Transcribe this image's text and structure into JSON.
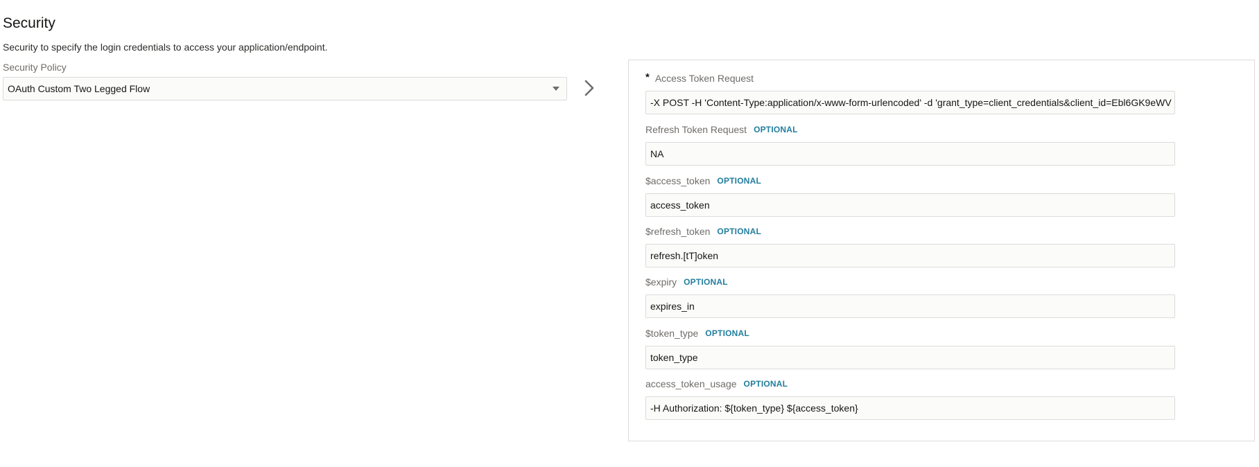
{
  "section": {
    "title": "Security",
    "description": "Security to specify the login credentials to access your application/endpoint."
  },
  "policy": {
    "label": "Security Policy",
    "value": "OAuth Custom Two Legged Flow"
  },
  "optional_tag": "OPTIONAL",
  "fields": [
    {
      "label": "Access Token Request",
      "required": true,
      "value": "-X POST -H 'Content-Type:application/x-www-form-urlencoded' -d 'grant_type=client_credentials&client_id=Ebl6GK9eWV"
    },
    {
      "label": "Refresh Token Request",
      "optional": "OPTIONAL",
      "value": "NA"
    },
    {
      "label": "$access_token",
      "optional": "OPTIONAL",
      "value": "access_token"
    },
    {
      "label": "$refresh_token",
      "optional": "OPTIONAL",
      "value": "refresh.[tT]oken"
    },
    {
      "label": "$expiry",
      "optional": "OPTIONAL",
      "value": "expires_in"
    },
    {
      "label": "$token_type",
      "optional": "OPTIONAL",
      "value": "token_type"
    },
    {
      "label": "access_token_usage",
      "optional": "OPTIONAL",
      "value": "-H Authorization: ${token_type} ${access_token}"
    }
  ],
  "required_marker": "*",
  "icons": {
    "dropdown": "caret-down-icon",
    "expand": "chevron-right-icon"
  },
  "colors": {
    "optional_accent": "#227e9e",
    "label_gray": "#6f6c69",
    "border": "#dcdbd9",
    "input_bg": "#fbfbfa"
  }
}
